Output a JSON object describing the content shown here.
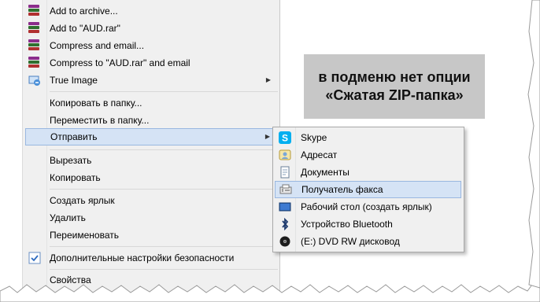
{
  "main_menu": {
    "items": [
      {
        "label": "Add to archive...",
        "icon": "winrar-icon"
      },
      {
        "label": "Add to \"AUD.rar\"",
        "icon": "winrar-icon"
      },
      {
        "label": "Compress and email...",
        "icon": "winrar-icon"
      },
      {
        "label": "Compress to \"AUD.rar\" and email",
        "icon": "winrar-icon"
      },
      {
        "label": "True Image",
        "icon": "true-image-icon",
        "has_submenu": true
      },
      {
        "label": "Копировать в папку..."
      },
      {
        "label": "Переместить в папку..."
      },
      {
        "label": "Отправить",
        "has_submenu": true,
        "highlighted": true
      },
      {
        "label": "Вырезать"
      },
      {
        "label": "Копировать"
      },
      {
        "label": "Создать ярлык"
      },
      {
        "label": "Удалить"
      },
      {
        "label": "Переименовать"
      },
      {
        "label": "Дополнительные настройки безопасности",
        "icon": "security-settings-icon"
      },
      {
        "label": "Свойства"
      }
    ]
  },
  "caption": {
    "line1": "в подменю нет опции",
    "line2": "«Сжатая ZIP-папка»"
  },
  "send_to_menu": {
    "items": [
      {
        "label": "Skype",
        "icon": "skype-icon"
      },
      {
        "label": "Адресат",
        "icon": "contact-icon"
      },
      {
        "label": "Документы",
        "icon": "documents-icon"
      },
      {
        "label": "Получатель факса",
        "icon": "fax-icon",
        "highlighted": true
      },
      {
        "label": "Рабочий стол (создать ярлык)",
        "icon": "desktop-icon"
      },
      {
        "label": "Устройство Bluetooth",
        "icon": "bluetooth-icon"
      },
      {
        "label": "(E:) DVD RW дисковод",
        "icon": "dvd-drive-icon"
      }
    ]
  },
  "colors": {
    "menu_bg": "#f0f0f0",
    "highlight_bg": "#d5e3f5",
    "highlight_border": "#99b7e0",
    "caption_bg": "#c7c7c7"
  }
}
